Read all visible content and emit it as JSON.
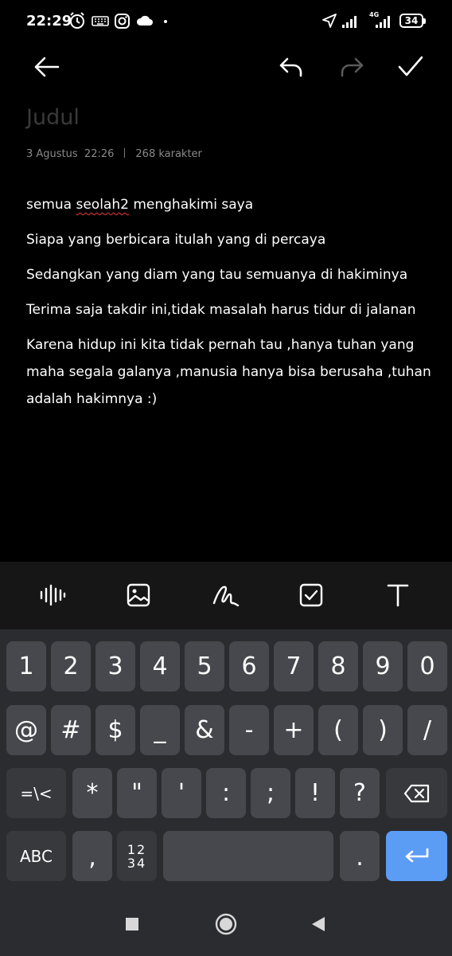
{
  "status_bar": {
    "time": "22:29",
    "network": "4G",
    "battery": "34",
    "icons": [
      "alarm-icon",
      "keyboard-icon",
      "instagram-icon",
      "cloud-icon",
      "dot-icon",
      "location-icon",
      "signal-icon",
      "signal-icon",
      "battery-icon"
    ]
  },
  "toolbar": {
    "back_icon": "arrow-left-icon",
    "undo_icon": "undo-icon",
    "redo_icon": "redo-icon",
    "save_icon": "checkmark-icon"
  },
  "note": {
    "title_placeholder": "Judul",
    "date": "3 Agustus  22:26",
    "char_count": "268 karakter",
    "lines": [
      {
        "before": "semua ",
        "typo": "seolah2",
        "after": " menghakimi saya"
      },
      {
        "text": "Siapa yang berbicara itulah yang di percaya"
      },
      {
        "text": "Sedangkan yang diam yang tau semuanya di hakiminya"
      },
      {
        "text": "Terima saja takdir ini,tidak masalah harus tidur di jalanan"
      },
      {
        "text": "Karena hidup ini kita tidak pernah tau ,hanya tuhan yang maha segala galanya ,manusia hanya bisa berusaha ,tuhan adalah hakimnya :)"
      }
    ]
  },
  "format_bar": {
    "items": [
      "audio-waveform-icon",
      "image-icon",
      "handwriting-icon",
      "checklist-icon",
      "text-format-icon"
    ]
  },
  "keyboard": {
    "row1": [
      "1",
      "2",
      "3",
      "4",
      "5",
      "6",
      "7",
      "8",
      "9",
      "0"
    ],
    "row2": [
      "@",
      "#",
      "$",
      "_",
      "&",
      "-",
      "+",
      "(",
      ")",
      "/"
    ],
    "row3": [
      "=\\<",
      "*",
      "\"",
      "'",
      ":",
      ";",
      "!",
      "?"
    ],
    "row4": {
      "abc": "ABC",
      "comma": ",",
      "numpad_top": "12",
      "numpad_bottom": "34",
      "period": "."
    },
    "backspace_icon": "backspace-icon",
    "enter_icon": "enter-icon"
  },
  "nav": {
    "items": [
      "recents-icon",
      "home-icon",
      "back-icon"
    ]
  },
  "colors": {
    "background": "#000000",
    "keyboard_bg": "#2b2c30",
    "key_bg": "#47484d",
    "enter_key": "#5b9cf5",
    "spellcheck": "#e53935"
  }
}
